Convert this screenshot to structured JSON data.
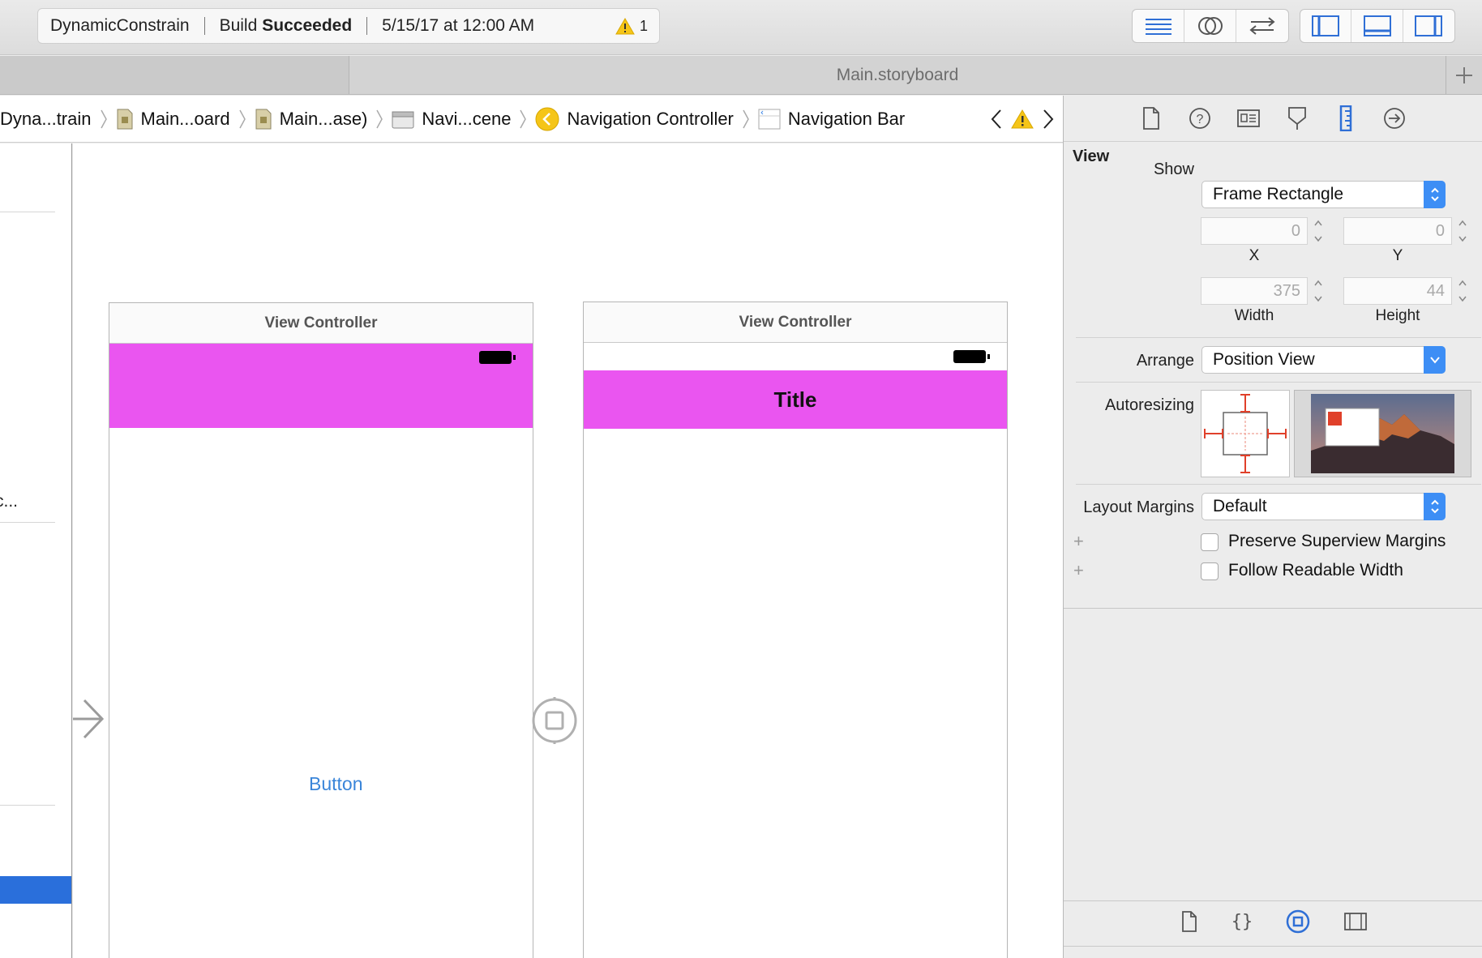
{
  "toolbar": {
    "scheme": "DynamicConstrain",
    "status_prefix": "Build",
    "status_bold": "Succeeded",
    "timestamp": "5/15/17 at 12:00 AM",
    "warning_count": "1"
  },
  "tabs": {
    "title": "Main.storyboard"
  },
  "jumpbar": {
    "crumbs": [
      "Dyna...train",
      "Main...oard",
      "Main...ase)",
      "Navi...cene",
      "Navigation Controller",
      "Navigation Bar"
    ]
  },
  "outline": {
    "truncated_item": "c..."
  },
  "canvas": {
    "scene1": {
      "title": "View Controller",
      "button_label": "Button"
    },
    "scene2": {
      "title": "View Controller",
      "nav_title": "Title"
    }
  },
  "inspector": {
    "section_title": "View",
    "show_label": "Show",
    "show_value": "Frame Rectangle",
    "x_value": "0",
    "y_value": "0",
    "x_caption": "X",
    "y_caption": "Y",
    "width_value": "375",
    "height_value": "44",
    "width_caption": "Width",
    "height_caption": "Height",
    "arrange_label": "Arrange",
    "arrange_value": "Position View",
    "autoresizing_label": "Autoresizing",
    "layout_margins_label": "Layout Margins",
    "layout_margins_value": "Default",
    "preserve_label": "Preserve Superview Margins",
    "readable_label": "Follow Readable Width"
  },
  "colors": {
    "accent": "#3d8ef5",
    "navbar_magenta": "#ea55f0",
    "selection_blue": "#2a6fdb",
    "button_text": "#3a85d9",
    "warning_yellow": "#f5c518",
    "constraint_red": "#e0402a"
  }
}
